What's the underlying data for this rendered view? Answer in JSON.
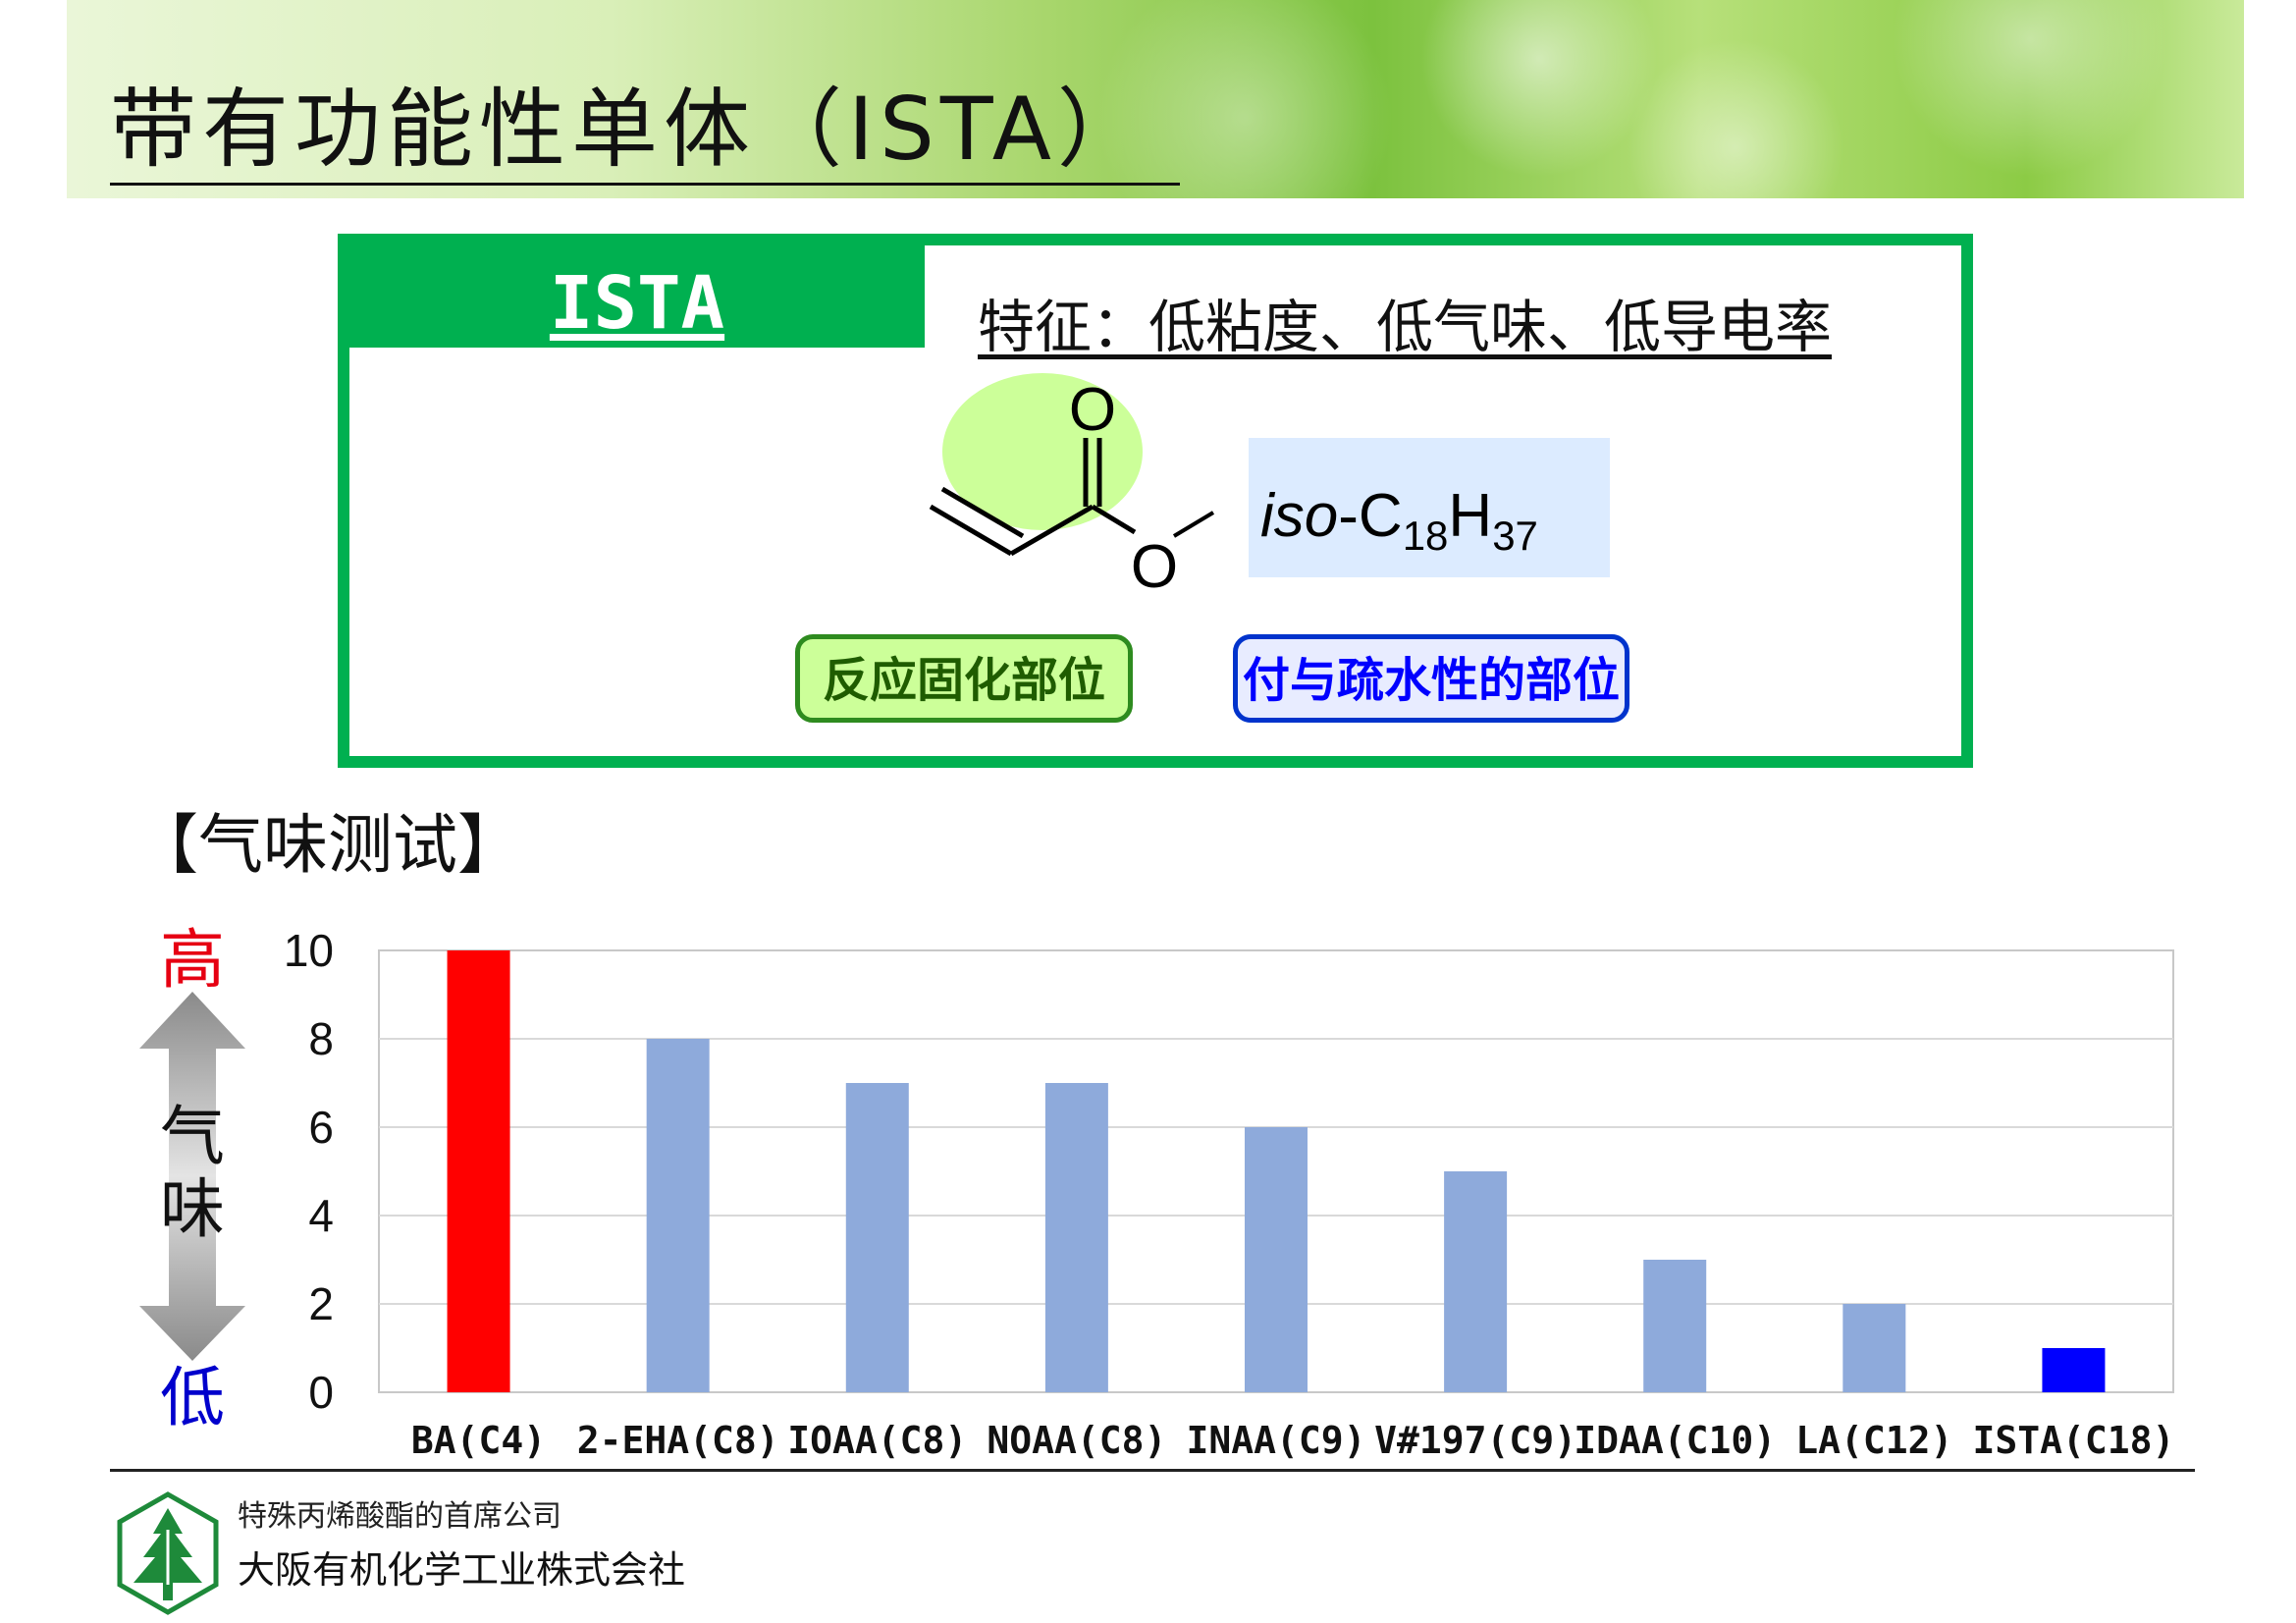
{
  "page": {
    "title": "带有功能性单体（ISTA）"
  },
  "panel": {
    "tab_label": "ISTA",
    "feature_text": "特征：低粘度、低气味、低导电率",
    "molecule": {
      "carbonyl_atom": "O",
      "ester_atom": "O",
      "substituent_prefix": "iso",
      "substituent_c": "-C",
      "substituent_c_sub": "18",
      "substituent_h": "H",
      "substituent_h_sub": "37"
    },
    "label_reactive": "反应固化部位",
    "label_hydrophobic": "付与疏水性的部位"
  },
  "section_title": "【气味测试】",
  "scale": {
    "high_label": "高",
    "low_label": "低",
    "axis_name_1": "气",
    "axis_name_2": "味"
  },
  "chart_data": {
    "type": "bar",
    "categories": [
      "BA(C4)",
      "2-EHA(C8)",
      "IOAA(C8)",
      "NOAA(C8)",
      "INAA(C9)",
      "V#197(C9)",
      "IDAA(C10)",
      "LA(C12)",
      "ISTA(C18)"
    ],
    "values": [
      10,
      8,
      7,
      7,
      6,
      5,
      3,
      2,
      1
    ],
    "ylim": [
      0,
      10
    ],
    "yticks": [
      0,
      2,
      4,
      6,
      8,
      10
    ],
    "grid": true,
    "colors": {
      "default": "#8eaadb",
      "highlight_high": "#ff0000",
      "highlight_low": "#0000ff"
    },
    "highlight_high_index": 0,
    "highlight_low_index": 8
  },
  "footer": {
    "tagline": "特殊丙烯酸酯的首席公司",
    "company": "大阪有机化学工业株式会社"
  },
  "colors": {
    "accent_green": "#00b050",
    "high_red": "#e60012",
    "low_blue": "#0000cc"
  }
}
